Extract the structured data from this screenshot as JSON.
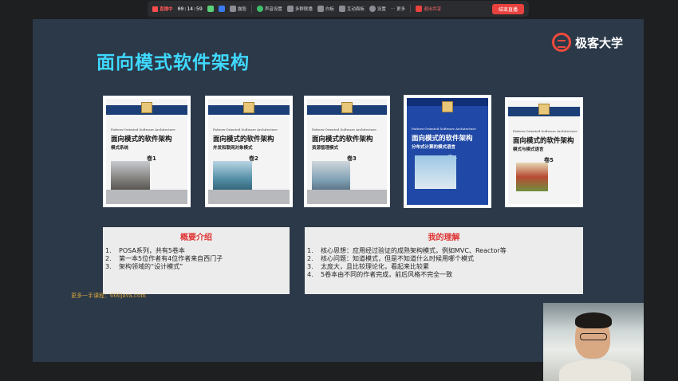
{
  "toolbar": {
    "live_label": "直播中",
    "timer": "00:14:59",
    "items": [
      "露脸",
      "声音设置",
      "多群联播",
      "白板",
      "互动面板",
      "设置",
      "更多"
    ],
    "exit_label": "退出共享",
    "end_label": "结束直播"
  },
  "slide": {
    "title": "面向模式软件架构",
    "logo_text": "极客大学",
    "watermark": "更多一手课程：666java.com",
    "books": [
      {
        "en": "Pattern-Oriented Software Architecture",
        "cn": "面向模式的软件架构",
        "sub": "模式系统",
        "vol": "卷1"
      },
      {
        "en": "Pattern-Oriented Software Architecture",
        "cn": "面向模式的软件架构",
        "sub": "并发和联网对象模式",
        "vol": "卷2"
      },
      {
        "en": "Pattern-Oriented Software Architecture",
        "cn": "面向模式的软件架构",
        "sub": "资源管理模式",
        "vol": "卷3"
      },
      {
        "en": "Pattern-Oriented Software Architecture",
        "cn": "面向模式的软件架构",
        "sub": "分布式计算的模式语言",
        "vol": "卷4"
      },
      {
        "en": "Pattern-Oriented Software Architecture",
        "cn": "面向模式的软件架构",
        "sub": "模式与模式语言",
        "vol": "卷5"
      }
    ],
    "left_panel": {
      "heading": "概要介绍",
      "items": [
        {
          "n": "1.",
          "t": "POSA系列，共有5卷本"
        },
        {
          "n": "2.",
          "t": "第一本5位作者有4位作者来自西门子"
        },
        {
          "n": "3.",
          "t": "架构领域的“设计模式”"
        }
      ]
    },
    "right_panel": {
      "heading": "我的理解",
      "items": [
        {
          "n": "1.",
          "t": "核心思想：应用经过验证的成熟架构模式，例如MVC、Reactor等"
        },
        {
          "n": "2.",
          "t": "核心问题：知道模式，但是不知道什么时候用哪个模式"
        },
        {
          "n": "3.",
          "t": "太庞大，且比较理论化，看起来比较累"
        },
        {
          "n": "4.",
          "t": "5卷本由不同的作者完成，前后风格不完全一致"
        }
      ]
    }
  }
}
